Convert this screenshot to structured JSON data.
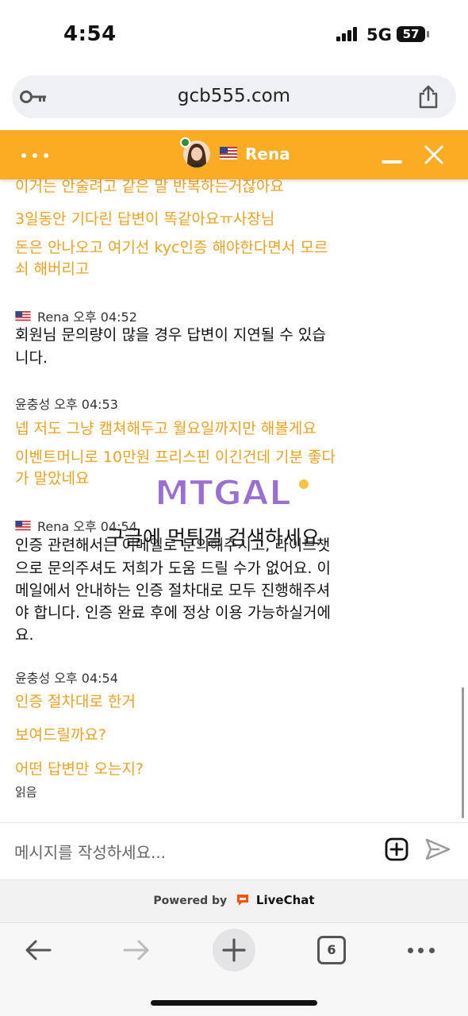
{
  "status_bar": {
    "time": "4:54",
    "network": "5G",
    "battery": "57"
  },
  "browser": {
    "url": "gcb555.com",
    "tab_count": "6"
  },
  "chat_header": {
    "agent_name": "Rena",
    "brand_color": "#fbac22"
  },
  "messages": {
    "m1": "이거는 안술려고 같은 말 반복하는거잖아요",
    "m2": "3일동안 기다린 답변이 똑같아요ㅠ사장님",
    "m3a": "돈은 안나오고 여기선 kyc인증 해야한다면서 모르",
    "m3b": "쇠 해버리고",
    "meta1": "Rena 오후 04:52",
    "m4a": "회원님 문의량이 많을 경우 답변이 지연될 수 있습",
    "m4b": "니다.",
    "meta2": "윤충성 오후 04:53",
    "m5": "넵 저도 그냥 캠쳐해두고 월요일까지만 해볼게요",
    "m6a": "이벤트머니로 10만원 프리스핀 이긴건데 기분 좋다",
    "m6b": "가 말았네요",
    "meta3": "Rena 오후 04:54",
    "m7a": "인증 관련해서는 이메일로 문의해주시고, 라이브챗",
    "m7b": "으로 문의주셔도 저희가 도움 드릴 수가 없어요. 이",
    "m7c": "메일에서 안내하는 인증 절차대로 모두 진행해주셔",
    "m7d": "야 합니다. 인증 완료 후에 정상 이용 가능하실거에",
    "m7e": "요.",
    "meta4": "윤충성 오후 04:54",
    "m8": "인증 절차대로 한거",
    "m9": "보여드릴까요?",
    "m10": "어떤 답변만 오는지?",
    "read": "읽음"
  },
  "watermark": {
    "logo": "MTGAL",
    "text": "구글에 먹튀갤 검색하세요"
  },
  "composer": {
    "placeholder": "메시지를 작성하세요..."
  },
  "footer": {
    "powered_by": "Powered by",
    "brand": "LiveChat"
  },
  "colors": {
    "visitor_text": "#f0a11e",
    "header": "#fbac22"
  },
  "icons": [
    "key-icon",
    "share-icon",
    "dots-menu-icon",
    "flag-us-icon",
    "minimize-icon",
    "close-icon",
    "attach-icon",
    "send-icon",
    "back-icon",
    "forward-icon",
    "plus-icon",
    "more-icon"
  ]
}
